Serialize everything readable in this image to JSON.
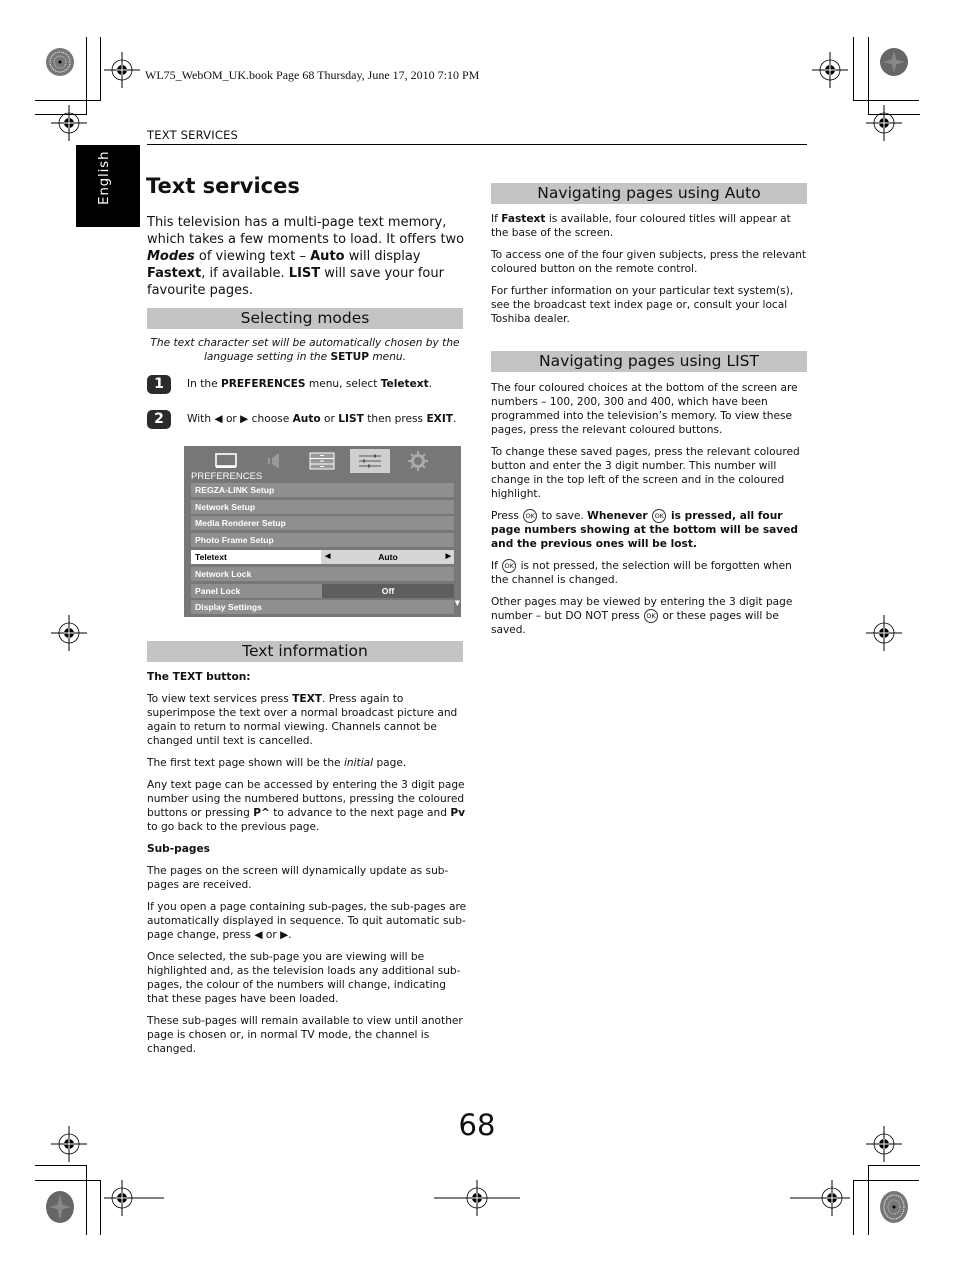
{
  "print_header": "WL75_WebOM_UK.book  Page 68  Thursday, June 17, 2010  7:10 PM",
  "running_head": "TEXT SERVICES",
  "language_tab": "English",
  "page_title": "Text services",
  "intro": {
    "parts": [
      "This television has a multi-page text memory, which takes a few moments to load. It offers two ",
      "Modes",
      " of viewing text – ",
      "Auto",
      " will display ",
      "Fastext",
      ", if available. ",
      "LIST",
      " will save your four favourite pages."
    ]
  },
  "selecting_modes": {
    "heading": "Selecting modes",
    "note_parts": [
      "The text character set will be automatically chosen by the language setting in the ",
      "SETUP",
      " menu."
    ],
    "steps": [
      {
        "num": "1",
        "parts": [
          "In the ",
          "PREFERENCES",
          " menu, select ",
          "Teletext",
          "."
        ]
      },
      {
        "num": "2",
        "parts": [
          "With ",
          "◀",
          " or ",
          "▶",
          " choose ",
          "Auto",
          " or ",
          "LIST",
          " then press ",
          "EXIT",
          "."
        ]
      }
    ]
  },
  "tv_menu": {
    "icons": [
      "picture-icon",
      "sound-icon",
      "setup-icon",
      "preferences-icon",
      "settings-gear-icon"
    ],
    "active_icon": "preferences-icon",
    "title": "PREFERENCES",
    "rows": [
      {
        "label": "REGZA-LINK Setup",
        "value": ""
      },
      {
        "label": "Network Setup",
        "value": ""
      },
      {
        "label": "Media Renderer Setup",
        "value": ""
      },
      {
        "label": "Photo Frame Setup",
        "value": ""
      },
      {
        "label": "Teletext",
        "value": "Auto",
        "selected": true
      },
      {
        "label": "Network Lock",
        "value": ""
      },
      {
        "label": "Panel Lock",
        "value": "Off"
      },
      {
        "label": "Display Settings",
        "value": ""
      }
    ],
    "arrow_left": "◀",
    "arrow_right": "▶",
    "scroll_indicator": "▼"
  },
  "text_information": {
    "heading": "Text information",
    "subhead_text_button": "The TEXT button:",
    "p1_parts": [
      "To view text services press ",
      "TEXT",
      ". Press again to superimpose the text over a normal broadcast picture and again to return to normal viewing. Channels cannot be changed until text is cancelled."
    ],
    "p2_parts": [
      "The first text page shown will be the ",
      "initial",
      " page."
    ],
    "p3_parts": [
      "Any text page can be accessed by entering the 3 digit page number using the numbered buttons, pressing the coloured buttons or pressing ",
      "P^",
      " to advance to the next page and ",
      "Pv",
      " to go back to the previous page."
    ],
    "subhead_subpages": "Sub-pages",
    "p4": "The pages on the screen will dynamically update as sub-pages are received.",
    "p5_parts": [
      "If you open a page containing sub-pages, the sub-pages are automatically displayed in sequence. To quit automatic sub-page change, press ",
      "◀",
      " or ",
      "▶",
      "."
    ],
    "p6": "Once selected, the sub-page you are viewing will be highlighted and, as the television loads any additional sub-pages, the colour of the numbers will change, indicating that these pages have been loaded.",
    "p7": "These sub-pages will remain available to view until another page is chosen or, in normal TV mode, the channel is changed."
  },
  "nav_auto": {
    "heading": "Navigating pages using Auto",
    "p1_parts": [
      "If ",
      "Fastext",
      " is available, four coloured titles will appear at the base of the screen."
    ],
    "p2": "To access one of the four given subjects, press the relevant coloured button on the remote control.",
    "p3": "For further information on your particular text system(s), see the broadcast text index page or, consult your local Toshiba dealer."
  },
  "nav_list": {
    "heading": "Navigating pages using LIST",
    "p1": "The four coloured choices at the bottom of the screen are numbers – 100, 200, 300 and 400, which have been programmed into the television’s memory. To view these pages, press the relevant coloured buttons.",
    "p2": "To change these saved pages, press the relevant coloured button and enter the 3 digit number. This number will change in the top left of the screen and in the coloured highlight.",
    "p3_parts": [
      "Press ",
      "OK",
      " to save. ",
      "Whenever ",
      "OK",
      " is pressed, all four page numbers showing at the bottom will be saved and the previous ones will be lost."
    ],
    "p4_parts": [
      "If ",
      "OK",
      " is not pressed, the selection will be forgotten when the channel is changed."
    ],
    "p5_parts": [
      "Other pages may be viewed by entering the 3 digit page number – but DO NOT press ",
      "OK",
      " or these pages will be saved."
    ]
  },
  "page_number": "68"
}
